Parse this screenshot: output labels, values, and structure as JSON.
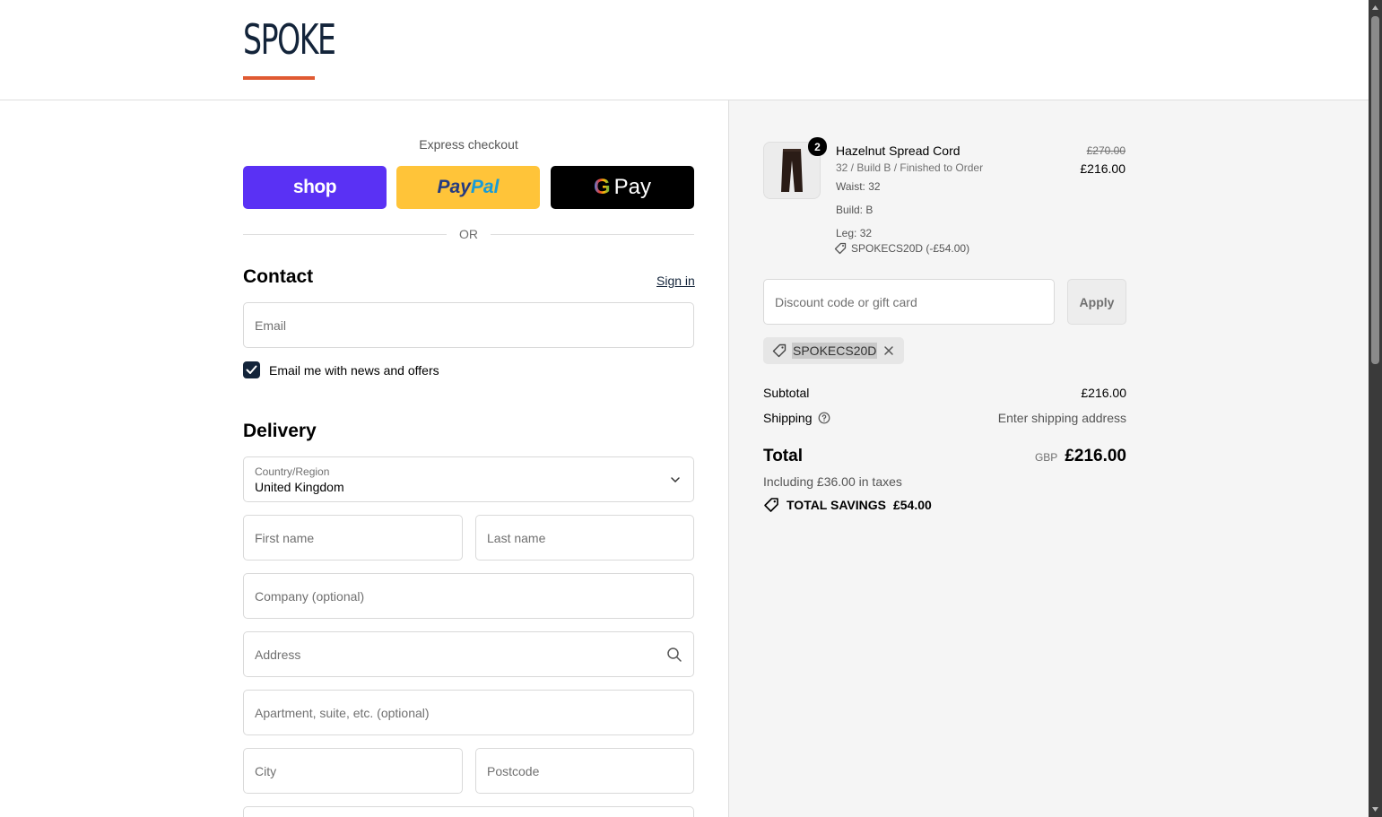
{
  "brand": {
    "logo_text": "SPOKE",
    "accent_color": "#e05a32",
    "navy": "#13243a"
  },
  "express": {
    "title": "Express checkout",
    "shop_label": "shop",
    "paypal_label_a": "Pay",
    "paypal_label_b": "Pal",
    "gpay_g": "G",
    "gpay_label": "Pay",
    "or_label": "OR"
  },
  "contact": {
    "heading": "Contact",
    "sign_in": "Sign in",
    "email_placeholder": "Email",
    "newsletter_label": "Email me with news and offers",
    "newsletter_checked": true
  },
  "delivery": {
    "heading": "Delivery",
    "country_label": "Country/Region",
    "country_value": "United Kingdom",
    "first_name_placeholder": "First name",
    "last_name_placeholder": "Last name",
    "company_placeholder": "Company (optional)",
    "address_placeholder": "Address",
    "apartment_placeholder": "Apartment, suite, etc. (optional)",
    "city_placeholder": "City",
    "postcode_placeholder": "Postcode"
  },
  "order": {
    "item": {
      "quantity": "2",
      "name": "Hazelnut Spread Cord",
      "variant": "32 / Build B / Finished to Order",
      "waist": "Waist: 32",
      "build": "Build: B",
      "leg": "Leg: 32",
      "discount": "SPOKECS20D (-£54.00)",
      "price_original": "£270.00",
      "price": "£216.00"
    },
    "discount_placeholder": "Discount code or gift card",
    "apply_label": "Apply",
    "applied_code": "SPOKECS20D",
    "subtotal_label": "Subtotal",
    "subtotal_value": "£216.00",
    "shipping_label": "Shipping",
    "shipping_value": "Enter shipping address",
    "total_label": "Total",
    "currency": "GBP",
    "total_value": "£216.00",
    "taxes": "Including £36.00 in taxes",
    "savings_label": "TOTAL SAVINGS",
    "savings_value": "£54.00"
  }
}
